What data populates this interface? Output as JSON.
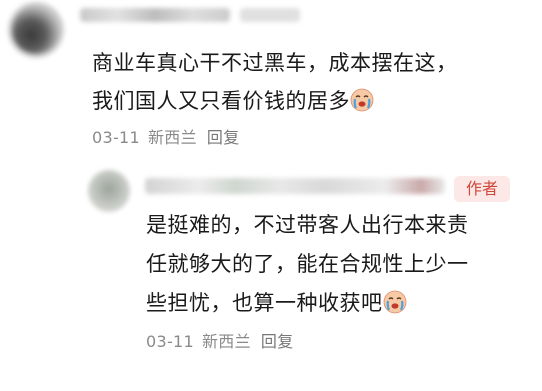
{
  "comment": {
    "text_line1": "商业车真心干不过黑车，成本摆在这，",
    "text_line2": "我们国人又只看价钱的居多",
    "emoji": "crying-face-icon",
    "date": "03-11",
    "location": "新西兰",
    "reply_label": "回复"
  },
  "reply": {
    "author_badge": "作者",
    "text_line1": "是挺难的，不过带客人出行本来责",
    "text_line2": "任就够大的了，能在合规性上少一",
    "text_line3": "些担忧，也算一种收获吧",
    "emoji": "crying-face-icon",
    "date": "03-11",
    "location": "新西兰",
    "reply_label": "回复"
  },
  "colors": {
    "badge_bg": "#fce9e7",
    "badge_text": "#d1473a",
    "meta_text": "#8a8a8a"
  }
}
